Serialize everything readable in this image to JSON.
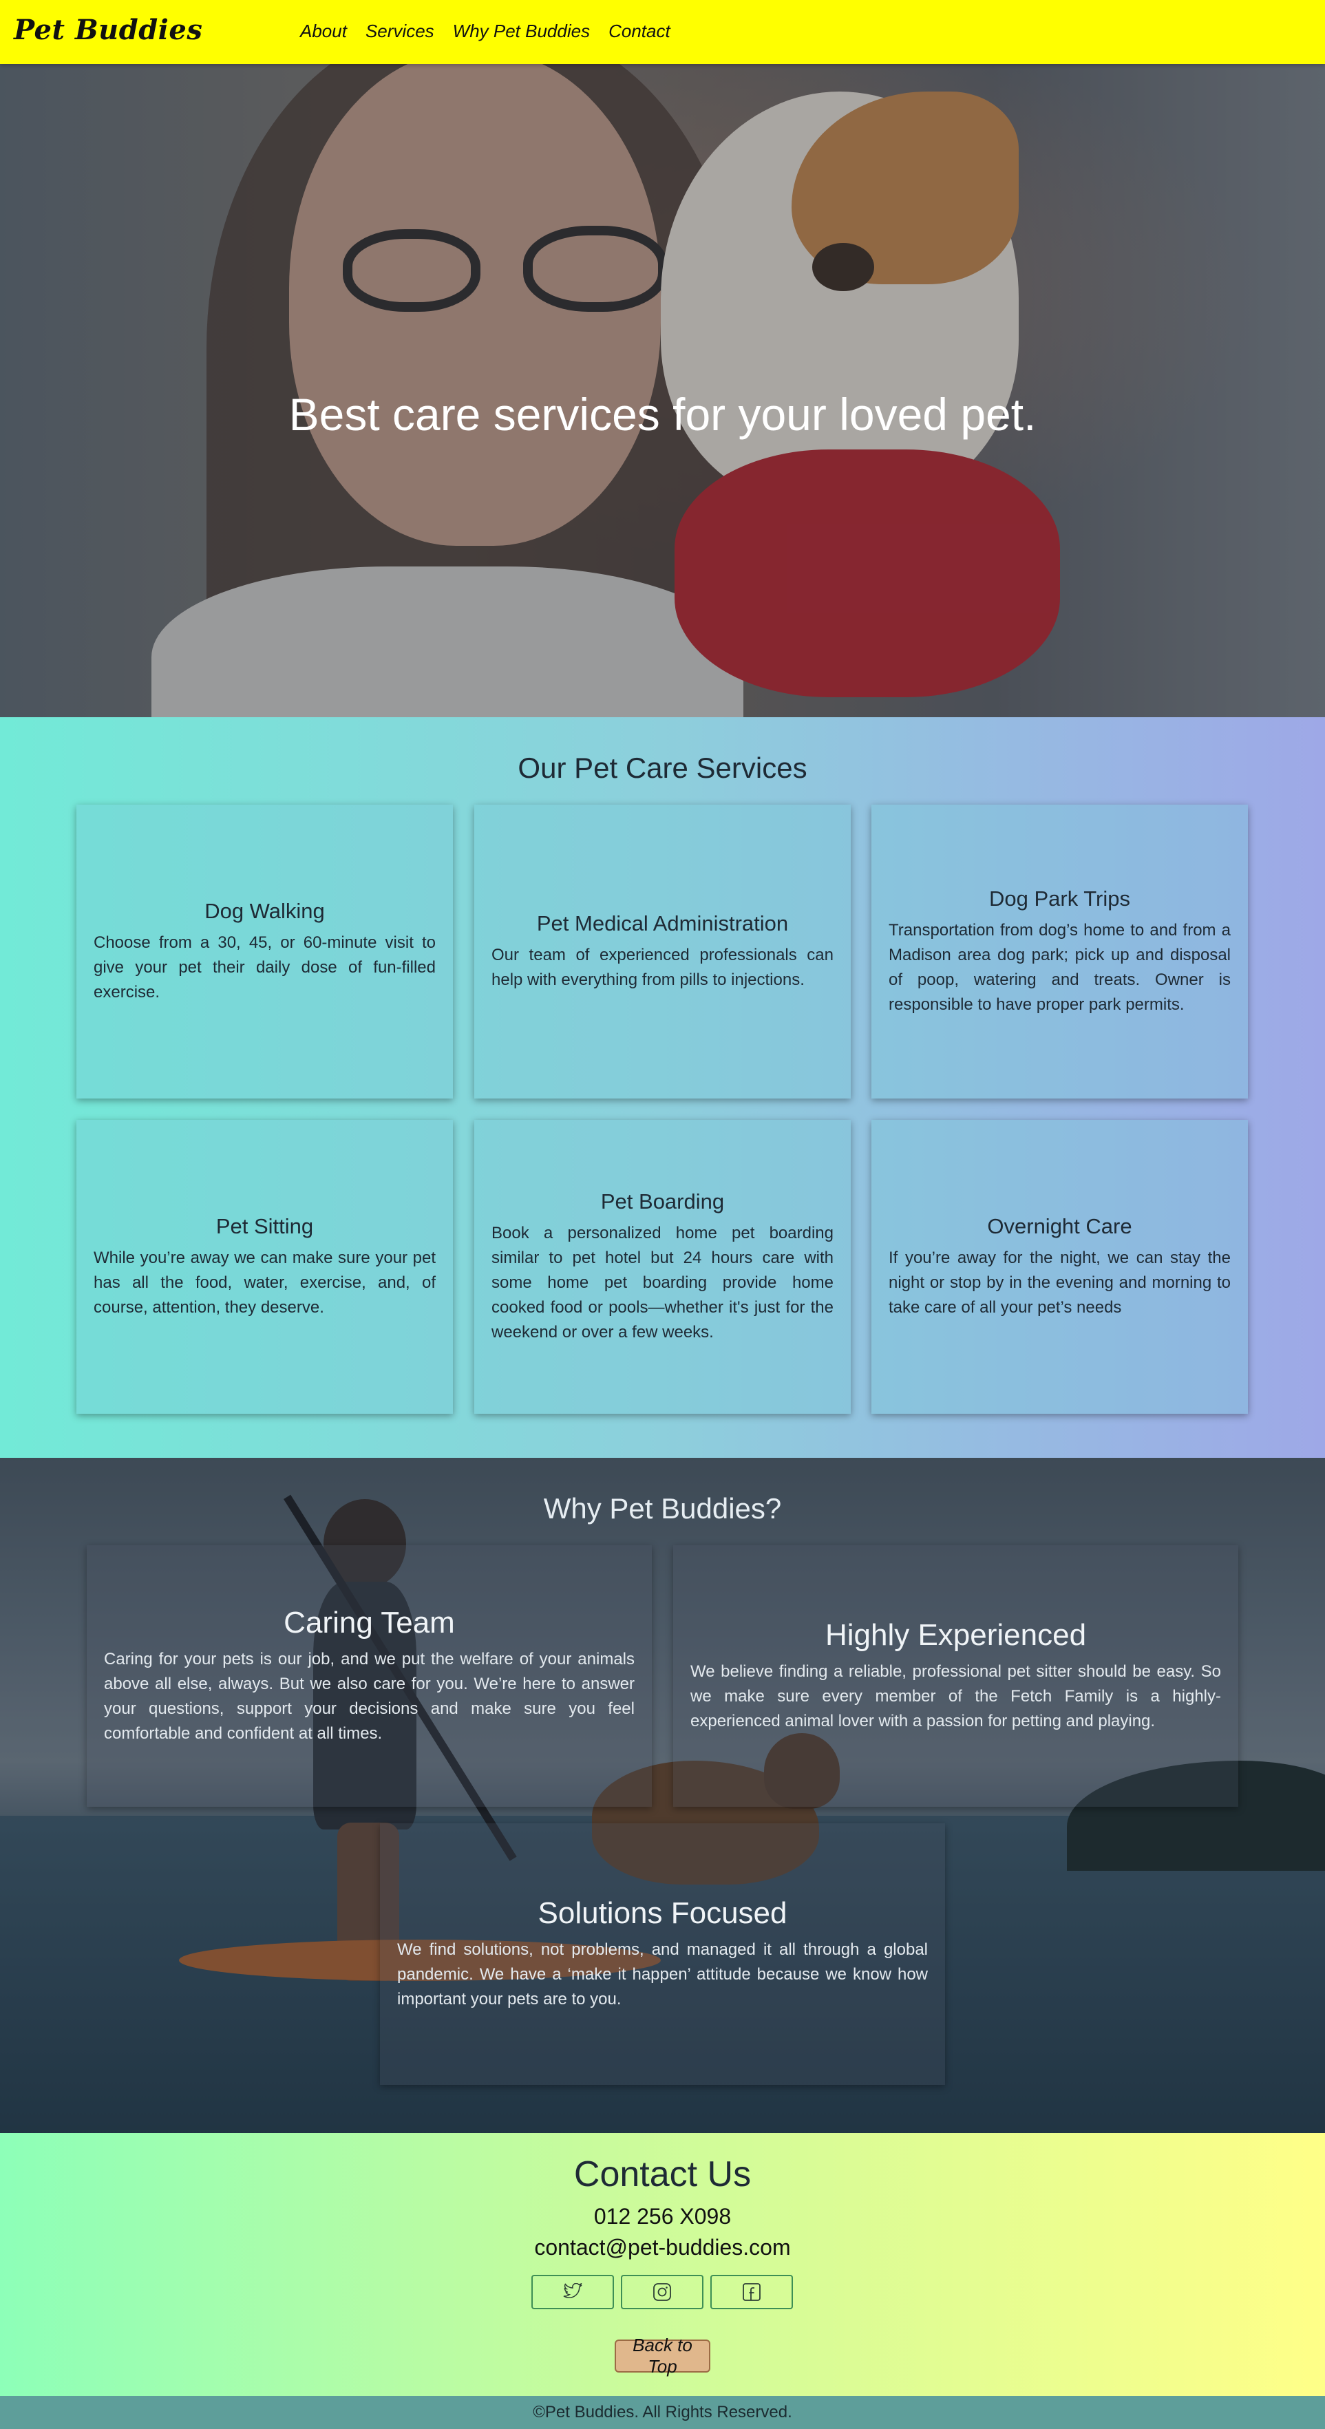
{
  "brand": {
    "name": "Pet Buddies"
  },
  "nav": {
    "items": [
      {
        "label": "About"
      },
      {
        "label": "Services"
      },
      {
        "label": "Why Pet Buddies"
      },
      {
        "label": "Contact"
      }
    ]
  },
  "hero": {
    "title": "Best care services for your loved pet."
  },
  "services": {
    "title": "Our Pet Care Services",
    "cards": [
      {
        "title": "Dog Walking",
        "text": "Choose from a 30, 45, or 60-minute visit to give your pet their daily dose of fun-filled exercise."
      },
      {
        "title": "Pet Medical Administration",
        "text": "Our team of experienced professionals can help with everything from pills to injections."
      },
      {
        "title": "Dog Park Trips",
        "text": "Transportation from dog’s home to and from a Madison area dog park; pick up and disposal of poop, watering and treats. Owner is responsible to have proper park permits."
      },
      {
        "title": "Pet Sitting",
        "text": "While you’re away we can make sure your pet has all the food, water, exercise, and, of course, attention, they deserve."
      },
      {
        "title": "Pet Boarding",
        "text": "Book a personalized home pet boarding similar to pet hotel but 24 hours care with some home pet boarding provide home cooked food or pools—whether it's just for the weekend or over a few weeks."
      },
      {
        "title": "Overnight Care",
        "text": "If you’re away for the night, we can stay the night or stop by in the evening and morning to take care of all your pet’s needs"
      }
    ]
  },
  "why": {
    "title": "Why Pet Buddies?",
    "cards": [
      {
        "title": "Caring Team",
        "text": "Caring for your pets is our job, and we put the welfare of your animals above all else, always. But we also care for you. We’re here to answer your questions, support your decisions and make sure you feel comfortable and confident at all times."
      },
      {
        "title": "Highly Experienced",
        "text": "We believe finding a reliable, professional pet sitter should be easy. So we make sure every member of the Fetch Family is a highly-experienced animal lover with a passion for petting and playing."
      },
      {
        "title": "Solutions Focused",
        "text": "We find solutions, not problems, and managed it all through a global pandemic. We have a ‘make it happen’ attitude because we know how important your pets are to you."
      }
    ]
  },
  "contact": {
    "title": "Contact Us",
    "phone": "012 256 X098",
    "email": "contact@pet-buddies.com",
    "socials": [
      {
        "icon": "twitter-icon"
      },
      {
        "icon": "instagram-icon"
      },
      {
        "icon": "facebook-icon"
      }
    ],
    "back_to_top": "Back to Top"
  },
  "footer": {
    "text": "©Pet Buddies. All Rights Reserved."
  },
  "colors": {
    "header_bg": "#ffff00",
    "services_gradient_start": "#72ead7",
    "services_gradient_end": "#9ea8e7",
    "contact_gradient_start": "#8dffb8",
    "contact_gradient_end": "#ffff88",
    "footer_bg": "#5e9e9a",
    "back_to_top_bg": "#e0b78c"
  }
}
